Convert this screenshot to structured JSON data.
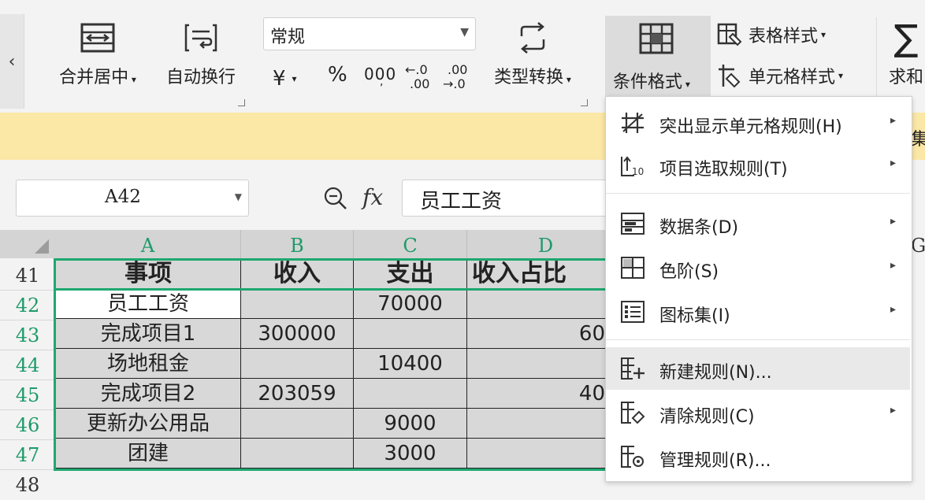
{
  "ribbon": {
    "merge_center": "合并居中",
    "auto_wrap": "自动换行",
    "number_format": "常规",
    "currency": "¥",
    "percent": "%",
    "thousands": "000",
    "dec_inc_top": "←.0",
    "dec_inc_bottom": ".00",
    "dec_dec_top": ".00",
    "dec_dec_bottom": "→.0",
    "type_convert": "类型转换",
    "cond_format": "条件格式",
    "table_style": "表格样式",
    "cell_style": "单元格样式",
    "sum": "求和"
  },
  "band": {
    "text": "集"
  },
  "formula_bar": {
    "name_box": "A42",
    "fx": "fx",
    "content": "员工工资"
  },
  "columns": [
    "A",
    "B",
    "C",
    "D",
    "G"
  ],
  "header_row": {
    "row": "41",
    "cells": [
      "事项",
      "收入",
      "支出",
      "收入占比"
    ]
  },
  "rows": [
    {
      "row": "42",
      "a": "员工工资",
      "b": "",
      "c": "70000",
      "d": ""
    },
    {
      "row": "43",
      "a": "完成项目1",
      "b": "300000",
      "c": "",
      "d": "60"
    },
    {
      "row": "44",
      "a": "场地租金",
      "b": "",
      "c": "10400",
      "d": ""
    },
    {
      "row": "45",
      "a": "完成项目2",
      "b": "203059",
      "c": "",
      "d": "40"
    },
    {
      "row": "46",
      "a": "更新办公用品",
      "b": "",
      "c": "9000",
      "d": ""
    },
    {
      "row": "47",
      "a": "团建",
      "b": "",
      "c": "3000",
      "d": ""
    }
  ],
  "next_row": "48",
  "menu": {
    "items": [
      {
        "label": "突出显示单元格规则(H)",
        "icon": "highlight-rules-icon",
        "submenu": true
      },
      {
        "label": "项目选取规则(T)",
        "icon": "top-bottom-rules-icon",
        "submenu": true
      },
      {
        "label": "数据条(D)",
        "icon": "data-bars-icon",
        "submenu": true
      },
      {
        "label": "色阶(S)",
        "icon": "color-scales-icon",
        "submenu": true
      },
      {
        "label": "图标集(I)",
        "icon": "icon-sets-icon",
        "submenu": true
      },
      {
        "label": "新建规则(N)...",
        "icon": "new-rule-icon",
        "submenu": false
      },
      {
        "label": "清除规则(C)",
        "icon": "clear-rules-icon",
        "submenu": true
      },
      {
        "label": "管理规则(R)...",
        "icon": "manage-rules-icon",
        "submenu": false
      }
    ]
  },
  "colors": {
    "selection": "#1ea86f",
    "band": "#fbe7a6",
    "cell_fill": "#d8d8d8",
    "menu_hover": "#e9e9e9"
  }
}
